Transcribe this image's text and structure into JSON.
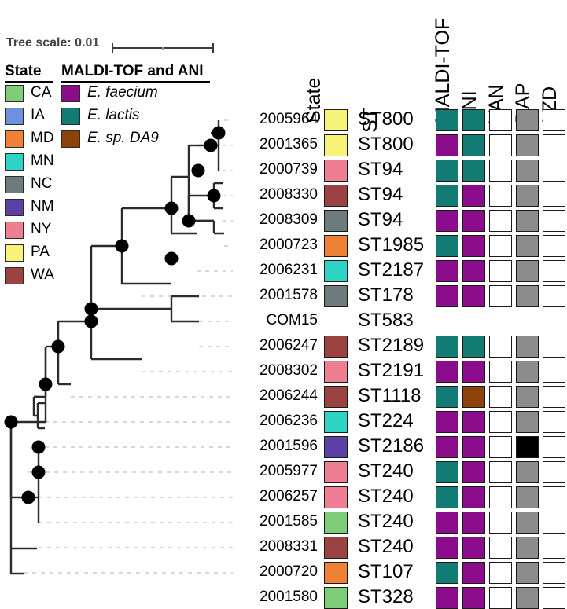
{
  "scale": {
    "label": "Tree scale: 0.01"
  },
  "legends": {
    "state": {
      "title": "State",
      "items": [
        {
          "label": "CA",
          "color": "#7ECE79"
        },
        {
          "label": "IA",
          "color": "#6D91DF"
        },
        {
          "label": "MD",
          "color": "#EE8136"
        },
        {
          "label": "MN",
          "color": "#2DD4C4"
        },
        {
          "label": "NC",
          "color": "#6E7B7C"
        },
        {
          "label": "NM",
          "color": "#5B41A6"
        },
        {
          "label": "NY",
          "color": "#EE7F92"
        },
        {
          "label": "PA",
          "color": "#F7F378"
        },
        {
          "label": "WA",
          "color": "#9B4343"
        }
      ]
    },
    "maldi": {
      "title": "MALDI-TOF and ANI",
      "items": [
        {
          "label": "E. faecium",
          "color": "#8C0D8C"
        },
        {
          "label": "E. lactis",
          "color": "#117B74"
        },
        {
          "label": "E. sp. DA9",
          "color": "#8C4209"
        }
      ]
    }
  },
  "columns": {
    "state": "State",
    "st": "ST",
    "maldi_tof": "MALDI-TOF",
    "ani": "ANI",
    "van": "VAN",
    "dap": "DAP",
    "lzd": "LZD"
  },
  "palette": {
    "faecium": "#8C0D8C",
    "lactis": "#117B74",
    "da9": "#8C4209",
    "susceptible": "#FFFFFF",
    "intermediate": "#8C8C8C",
    "resistant": "#000000",
    "branch": "#2b2b2b",
    "node": "#000000",
    "dash": "#cccccc"
  },
  "rows": [
    {
      "tip": "2005964",
      "state": "PA",
      "state_color": "#F7F378",
      "st": "ST800",
      "maldi": "#117B74",
      "ani": "#117B74",
      "van": "#FFFFFF",
      "dap": "#8C8C8C",
      "lzd": "#FFFFFF"
    },
    {
      "tip": "2001365",
      "state": "PA",
      "state_color": "#F7F378",
      "st": "ST800",
      "maldi": "#8C0D8C",
      "ani": "#117B74",
      "van": "#FFFFFF",
      "dap": "#8C8C8C",
      "lzd": "#FFFFFF"
    },
    {
      "tip": "2000739",
      "state": "NY",
      "state_color": "#EE7F92",
      "st": "ST94",
      "maldi": "#117B74",
      "ani": "#117B74",
      "van": "#FFFFFF",
      "dap": "#8C8C8C",
      "lzd": "#FFFFFF"
    },
    {
      "tip": "2008330",
      "state": "WA",
      "state_color": "#9B4343",
      "st": "ST94",
      "maldi": "#117B74",
      "ani": "#8C0D8C",
      "van": "#FFFFFF",
      "dap": "#8C8C8C",
      "lzd": "#FFFFFF"
    },
    {
      "tip": "2008309",
      "state": "NC",
      "state_color": "#6E7B7C",
      "st": "ST94",
      "maldi": "#8C0D8C",
      "ani": "#8C0D8C",
      "van": "#FFFFFF",
      "dap": "#8C8C8C",
      "lzd": "#FFFFFF"
    },
    {
      "tip": "2000723",
      "state": "MD",
      "state_color": "#EE8136",
      "st": "ST1985",
      "maldi": "#117B74",
      "ani": "#8C0D8C",
      "van": "#FFFFFF",
      "dap": "#8C8C8C",
      "lzd": "#FFFFFF"
    },
    {
      "tip": "2006231",
      "state": "MN",
      "state_color": "#2DD4C4",
      "st": "ST2187",
      "maldi": "#8C0D8C",
      "ani": "#8C0D8C",
      "van": "#FFFFFF",
      "dap": "#8C8C8C",
      "lzd": "#FFFFFF"
    },
    {
      "tip": "2001578",
      "state": "NC",
      "state_color": "#6E7B7C",
      "st": "ST178",
      "maldi": "#8C0D8C",
      "ani": "#8C0D8C",
      "van": "#FFFFFF",
      "dap": "#8C8C8C",
      "lzd": "#FFFFFF"
    },
    {
      "tip": "COM15",
      "state": "",
      "state_color": "",
      "st": "ST583",
      "maldi": "",
      "ani": "",
      "van": "",
      "dap": "",
      "lzd": ""
    },
    {
      "tip": "2006247",
      "state": "WA",
      "state_color": "#9B4343",
      "st": "ST2189",
      "maldi": "#117B74",
      "ani": "#117B74",
      "van": "#FFFFFF",
      "dap": "#8C8C8C",
      "lzd": "#FFFFFF"
    },
    {
      "tip": "2008302",
      "state": "NY",
      "state_color": "#EE7F92",
      "st": "ST2191",
      "maldi": "#8C0D8C",
      "ani": "#8C0D8C",
      "van": "#FFFFFF",
      "dap": "#8C8C8C",
      "lzd": "#FFFFFF"
    },
    {
      "tip": "2006244",
      "state": "WA",
      "state_color": "#9B4343",
      "st": "ST1118",
      "maldi": "#117B74",
      "ani": "#8C4209",
      "van": "#FFFFFF",
      "dap": "#8C8C8C",
      "lzd": "#FFFFFF"
    },
    {
      "tip": "2006236",
      "state": "MN",
      "state_color": "#2DD4C4",
      "st": "ST224",
      "maldi": "#8C0D8C",
      "ani": "#8C0D8C",
      "van": "#FFFFFF",
      "dap": "#8C8C8C",
      "lzd": "#FFFFFF"
    },
    {
      "tip": "2001596",
      "state": "NM",
      "state_color": "#5B41A6",
      "st": "ST2186",
      "maldi": "#8C0D8C",
      "ani": "#8C0D8C",
      "van": "#FFFFFF",
      "dap": "#000000",
      "lzd": "#FFFFFF"
    },
    {
      "tip": "2005977",
      "state": "NY",
      "state_color": "#EE7F92",
      "st": "ST240",
      "maldi": "#117B74",
      "ani": "#8C0D8C",
      "van": "#FFFFFF",
      "dap": "#8C8C8C",
      "lzd": "#FFFFFF"
    },
    {
      "tip": "2006257",
      "state": "NY",
      "state_color": "#EE7F92",
      "st": "ST240",
      "maldi": "#117B74",
      "ani": "#8C0D8C",
      "van": "#FFFFFF",
      "dap": "#8C8C8C",
      "lzd": "#FFFFFF"
    },
    {
      "tip": "2001585",
      "state": "CA",
      "state_color": "#7ECE79",
      "st": "ST240",
      "maldi": "#8C0D8C",
      "ani": "#8C0D8C",
      "van": "#FFFFFF",
      "dap": "#8C8C8C",
      "lzd": "#FFFFFF"
    },
    {
      "tip": "2008331",
      "state": "WA",
      "state_color": "#9B4343",
      "st": "ST240",
      "maldi": "#8C0D8C",
      "ani": "#8C0D8C",
      "van": "#FFFFFF",
      "dap": "#8C8C8C",
      "lzd": "#FFFFFF"
    },
    {
      "tip": "2000720",
      "state": "MD",
      "state_color": "#EE8136",
      "st": "ST107",
      "maldi": "#117B74",
      "ani": "#8C0D8C",
      "van": "#FFFFFF",
      "dap": "#8C8C8C",
      "lzd": "#FFFFFF"
    },
    {
      "tip": "2001580",
      "state": "CA",
      "state_color": "#7ECE79",
      "st": "ST328",
      "maldi": "#8C0D8C",
      "ani": "#8C0D8C",
      "van": "#FFFFFF",
      "dap": "#8C8C8C",
      "lzd": "#FFFFFF"
    }
  ],
  "chart_data": {
    "type": "tree",
    "title": "",
    "scale_bar": "Tree scale: 0.01",
    "n_taxa": 20,
    "tip_order": [
      "2005964",
      "2001365",
      "2000739",
      "2008330",
      "2008309",
      "2000723",
      "2006231",
      "2001578",
      "COM15",
      "2006247",
      "2008302",
      "2006244",
      "2006236",
      "2001596",
      "2005977",
      "2006257",
      "2001585",
      "2008331",
      "2000720",
      "2001580"
    ],
    "support_nodes": 14
  }
}
